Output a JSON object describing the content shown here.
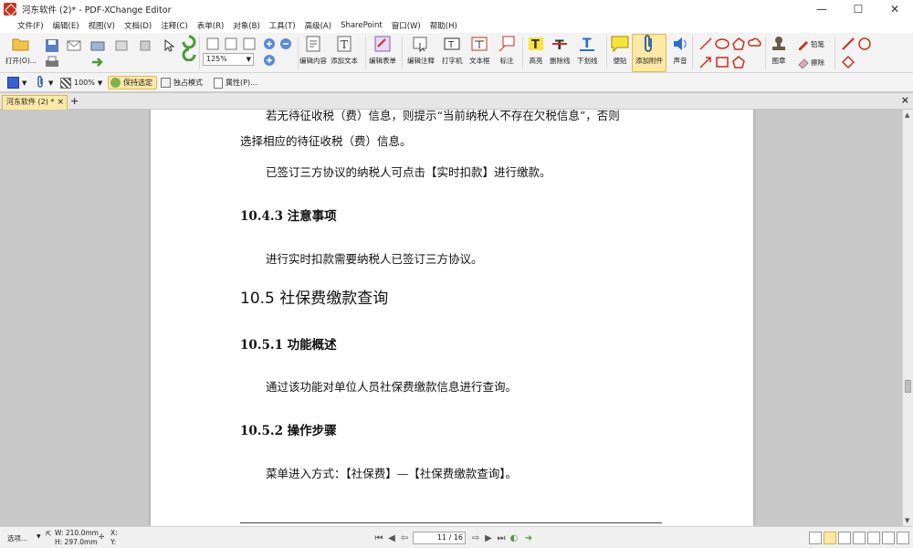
{
  "titlebar": {
    "title": "河东软件 (2)* - PDF-XChange Editor",
    "minimize": "—",
    "maximize": "☐",
    "close": "✕"
  },
  "menubar": {
    "items": [
      "文件(F)",
      "编辑(E)",
      "视图(V)",
      "文档(D)",
      "注释(C)",
      "表单(R)",
      "对象(B)",
      "工具(T)",
      "高级(A)",
      "SharePoint",
      "窗口(W)",
      "帮助(H)"
    ]
  },
  "ribbon": {
    "open_label": "打开(O)...",
    "zoom_value": "125%",
    "edit_content": "编辑内容",
    "add_text": "添加文本",
    "edit_form": "编辑表单",
    "edit_annotation": "编辑注释",
    "typewriter": "打字机",
    "text_box": "文本框",
    "callout": "标注",
    "highlight": "高亮",
    "strikeout": "删除线",
    "underline": "下划线",
    "sticky_note": "便贴",
    "add_attachment": "添加附件",
    "sound": "声音",
    "stamp": "图章",
    "pencil": "铅笔",
    "eraser": "擦除"
  },
  "toolbar2": {
    "opacity": "100%",
    "keep_selected": "保持选定",
    "exclusive_mode": "独占模式",
    "properties": "属性(P)..."
  },
  "tabs": {
    "doc_tab": "河东软件 (2) *",
    "tab_close": "×",
    "add_tab": "+",
    "panel_close": "×"
  },
  "document": {
    "line1": "若无待征收税（费）信息，则提示“当前纳税人不存在欠税信息”，否则",
    "line2": "选择相应的待征收税（费）信息。",
    "line3": "已签订三方协议的纳税人可点击【实时扣款】进行缴款。",
    "h_1043": "10.4.3 注意事项",
    "line4": "进行实时扣款需要纳税人已签订三方协议。",
    "h_105": "10.5 社保费缴款查询",
    "h_1051": "10.5.1 功能概述",
    "line5": "通过该功能对单位人员社保费缴款信息进行查询。",
    "h_1052": "10.5.2 操作步骤",
    "line6": "菜单进入方式：【社保费】—【社保费缴款查询】。"
  },
  "statusbar": {
    "options": "选项...",
    "width": "W: 210.0mm",
    "height": "H: 297.0mm",
    "x": "X:",
    "y": "Y:",
    "page_value": "11 / 16"
  },
  "colors": {
    "accent_yellow": "#fde9a6",
    "app_red": "#c8321e"
  }
}
